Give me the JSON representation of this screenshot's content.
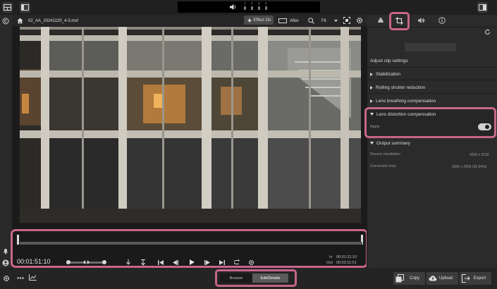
{
  "colors": {
    "highlight": "#c8658a",
    "panel_bg": "#2b2b2b",
    "topbar_bg": "#202020",
    "viewer_bg": "#1b1b1b"
  },
  "topbar": {
    "left_icon": "layout-icon",
    "panel_icon": "sidebar-toggle-icon",
    "right_icon": "right-panel-icon",
    "speaker_icon": "speaker-icon",
    "channels": [
      "1",
      "2",
      "3",
      "4"
    ]
  },
  "viewer": {
    "clip_name": "02_AA_20241120_4-3.mxf",
    "effect_label": "Effect On",
    "after_label": "After",
    "fit_label": "Fit"
  },
  "timeline": {
    "timecode": "00:01:51:10",
    "in_label": "In",
    "in_time": "00:01:31:10",
    "out_label": "Out",
    "out_time": "00:02:11:01"
  },
  "right_panel": {
    "title": "Adjust clip settings",
    "sections": {
      "stabilization": "Stabilization",
      "rolling_shutter": "Rolling shutter reduction",
      "lens_breathing": "Lens breathing compensation",
      "lens_distortion": "Lens distortion compensation",
      "apply_label": "Apply",
      "apply_on": true,
      "output_summary": "Output summary"
    },
    "summary": {
      "source_resolution_label": "Source resolution",
      "source_resolution_value": "4256 x 3192",
      "corrected_crop_label": "Corrected crop",
      "corrected_crop_value": "3942 x 2956 (92.64%)"
    }
  },
  "bottombar": {
    "browse_label": "Browse",
    "edit_details_label": "Edit/Details",
    "copy_label": "Copy",
    "upload_label": "Upload",
    "export_label": "Export"
  }
}
